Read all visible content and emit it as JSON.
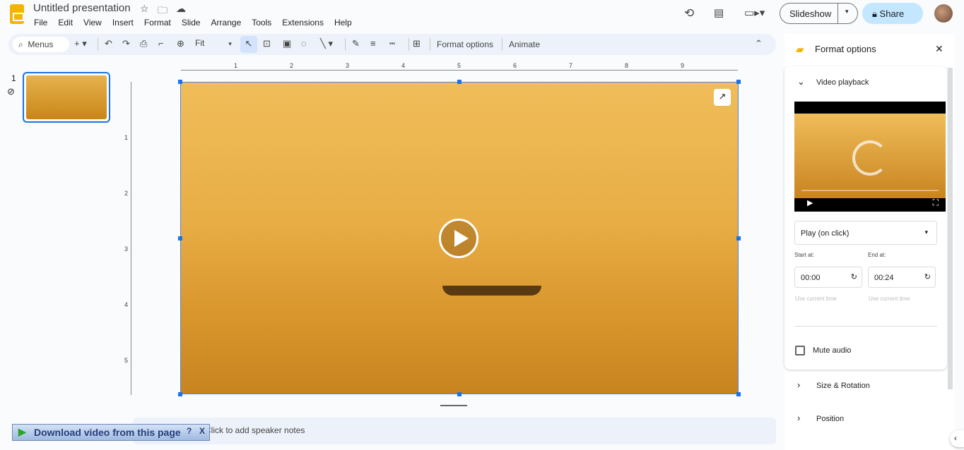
{
  "app": {
    "title": "Untitled presentation",
    "menu": [
      "File",
      "Edit",
      "View",
      "Insert",
      "Format",
      "Slide",
      "Arrange",
      "Tools",
      "Extensions",
      "Help"
    ],
    "slideshow": "Slideshow",
    "share": "Share"
  },
  "toolbar": {
    "search": "Menus",
    "zoom": "Fit",
    "format_options": "Format options",
    "animate": "Animate"
  },
  "ruler": {
    "h": [
      "1",
      "2",
      "3",
      "4",
      "5",
      "6",
      "7",
      "8",
      "9"
    ],
    "v": [
      "1",
      "2",
      "3",
      "4",
      "5"
    ]
  },
  "slides": {
    "number": "1"
  },
  "notes": {
    "placeholder": "Click to add speaker notes"
  },
  "extension": {
    "download": "Download video from this page",
    "help": "?",
    "close": "X"
  },
  "panel": {
    "title": "Format options",
    "video_playback": "Video playback",
    "play_mode": "Play (on click)",
    "start_label": "Start at:",
    "end_label": "End at:",
    "start": "00:00",
    "end": "00:24",
    "use_current": "Use current time",
    "mute": "Mute audio",
    "size_rotation": "Size & Rotation",
    "position": "Position"
  },
  "colors": {
    "accent": "#1a73e8",
    "share_bg": "#c2e7ff",
    "video": "#e8ad45"
  }
}
